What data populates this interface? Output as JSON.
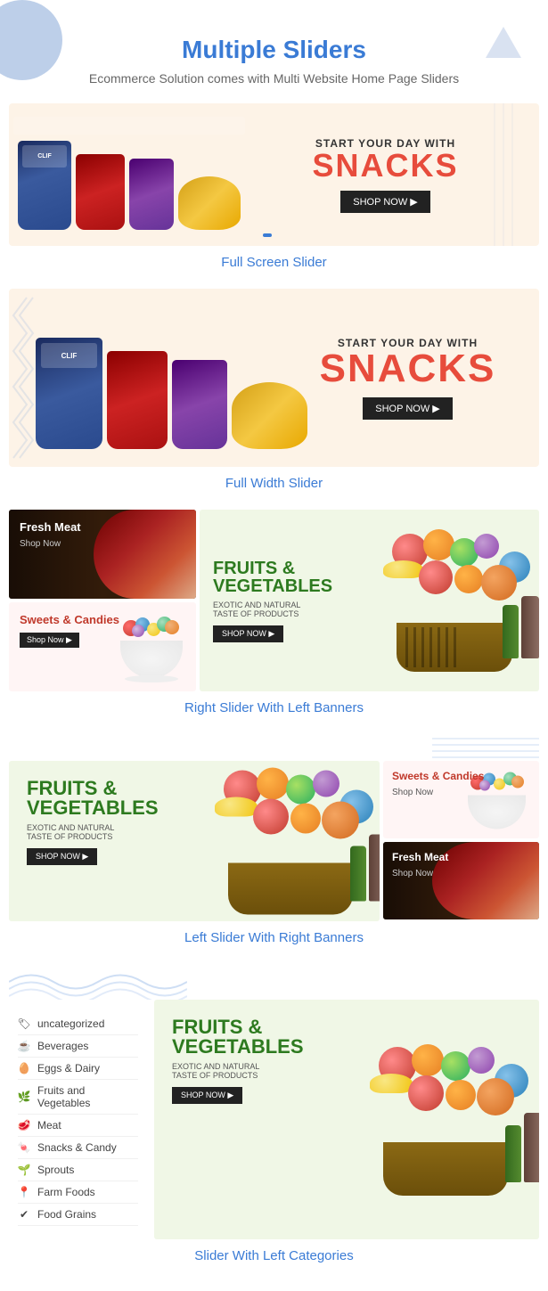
{
  "page": {
    "title": "Multiple Sliders",
    "subtitle": "Ecommerce Solution comes with Multi Website Home Page Sliders"
  },
  "sections": [
    {
      "id": "full-screen",
      "label": "Full Screen Slider"
    },
    {
      "id": "full-width",
      "label": "Full Width Slider"
    },
    {
      "id": "right-slider",
      "label": "Right Slider With Left Banners"
    },
    {
      "id": "left-slider",
      "label": "Left Slider With Right Banners"
    },
    {
      "id": "cat-slider",
      "label": "Slider With Left Categories"
    }
  ],
  "slider1": {
    "tagline": "START YOUR DAY WITH",
    "title": "SNACKS",
    "button": "SHOP NOW"
  },
  "slider2": {
    "tagline": "START YOUR DAY WITH",
    "title": "SNACKS",
    "button": "SHOP NOW"
  },
  "fruitsSlider": {
    "title1": "FRUITS &",
    "title2": "VEGETABLES",
    "subtitle": "EXOTIC AND NATURAL",
    "subtitle2": "TASTE OF PRODUCTS",
    "button": "SHOP NOW"
  },
  "banners": {
    "freshMeat": {
      "title": "Fresh Meat",
      "link": "Shop Now"
    },
    "sweetsAndCandies": {
      "title": "Sweets & Candies",
      "link": "Shop Now"
    }
  },
  "categories": [
    {
      "id": "uncategorized",
      "label": "uncategorized",
      "icon": "tag"
    },
    {
      "id": "beverages",
      "label": "Beverages",
      "icon": "cup"
    },
    {
      "id": "eggs-dairy",
      "label": "Eggs & Dairy",
      "icon": "egg"
    },
    {
      "id": "fruits-veg",
      "label": "Fruits and Vegetables",
      "icon": "leaf"
    },
    {
      "id": "meat",
      "label": "Meat",
      "icon": "meat"
    },
    {
      "id": "snacks-candy",
      "label": "Snacks & Candy",
      "icon": "candy"
    },
    {
      "id": "sprouts",
      "label": "Sprouts",
      "icon": "sprout"
    },
    {
      "id": "farm-foods",
      "label": "Farm Foods",
      "icon": "farm"
    },
    {
      "id": "food-grains",
      "label": "Food Grains",
      "icon": "grain"
    }
  ],
  "icons": {
    "tag": "🏷",
    "cup": "☕",
    "egg": "🥚",
    "leaf": "🌿",
    "meat": "🥩",
    "candy": "🍬",
    "sprout": "🌱",
    "farm": "📍",
    "grain": "✔"
  }
}
